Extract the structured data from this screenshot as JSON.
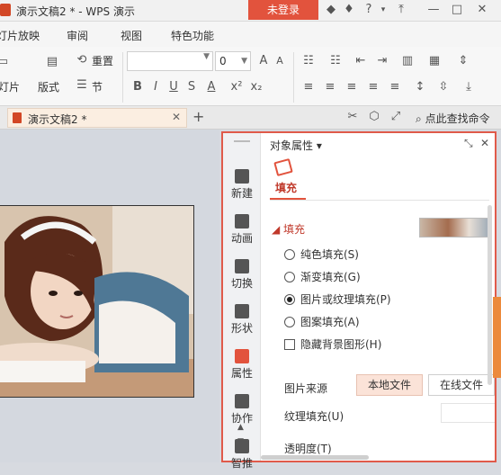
{
  "window": {
    "title": "演示文稿2 * - WPS 演示",
    "login_label": "未登录"
  },
  "menu": {
    "tabs": [
      "灯片放映",
      "审阅",
      "视图",
      "特色功能"
    ]
  },
  "ribbon": {
    "reset_label": "重置",
    "slide_label": "灯片",
    "layout_label": "版式",
    "section_label": "节",
    "font_size": "0"
  },
  "doc_tabs": {
    "active_tab": "演示文稿2 *",
    "search_cmd": "点此查找命令"
  },
  "sidebar": {
    "items": [
      {
        "label": "新建",
        "icon": "new-icon"
      },
      {
        "label": "动画",
        "icon": "animation-icon"
      },
      {
        "label": "切换",
        "icon": "transition-icon"
      },
      {
        "label": "形状",
        "icon": "shape-icon"
      },
      {
        "label": "属性",
        "icon": "property-icon"
      },
      {
        "label": "协作",
        "icon": "collab-icon"
      },
      {
        "label": "智推",
        "icon": "recommend-icon"
      }
    ]
  },
  "properties": {
    "title": "对象属性 ▾",
    "tab_fill": "填充",
    "section_fill": "填充",
    "options": [
      {
        "label": "纯色填充(S)",
        "type": "radio",
        "selected": false
      },
      {
        "label": "渐变填充(G)",
        "type": "radio",
        "selected": false
      },
      {
        "label": "图片或纹理填充(P)",
        "type": "radio",
        "selected": true
      },
      {
        "label": "图案填充(A)",
        "type": "radio",
        "selected": false
      },
      {
        "label": "隐藏背景图形(H)",
        "type": "checkbox",
        "selected": false
      }
    ],
    "image_source_label": "图片来源",
    "local_file": "本地文件",
    "online_file": "在线文件",
    "texture_fill_label": "纹理填充(U)",
    "transparency_label": "透明度(T)"
  },
  "colors": {
    "accent": "#e2533d",
    "panel_border": "#e05a4a",
    "login_bg": "#e2533d"
  }
}
